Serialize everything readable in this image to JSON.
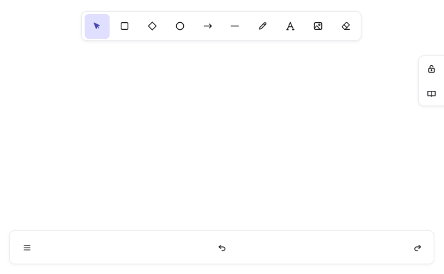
{
  "toolbar": {
    "tools": [
      {
        "id": "selection",
        "icon": "pointer-icon",
        "active": true
      },
      {
        "id": "rectangle",
        "icon": "rectangle-icon",
        "active": false
      },
      {
        "id": "diamond",
        "icon": "diamond-icon",
        "active": false
      },
      {
        "id": "ellipse",
        "icon": "ellipse-icon",
        "active": false
      },
      {
        "id": "arrow",
        "icon": "arrow-icon",
        "active": false
      },
      {
        "id": "line",
        "icon": "line-icon",
        "active": false
      },
      {
        "id": "draw",
        "icon": "pencil-icon",
        "active": false
      },
      {
        "id": "text",
        "icon": "text-icon",
        "active": false
      },
      {
        "id": "image",
        "icon": "image-icon",
        "active": false
      },
      {
        "id": "eraser",
        "icon": "eraser-icon",
        "active": false
      }
    ],
    "text_tool_glyph": "A"
  },
  "side_panel": {
    "items": [
      {
        "id": "lock",
        "icon": "unlock-icon"
      },
      {
        "id": "library",
        "icon": "book-icon"
      }
    ]
  },
  "bottom_bar": {
    "items": [
      {
        "id": "menu",
        "icon": "hamburger-menu-icon"
      },
      {
        "id": "undo",
        "icon": "undo-icon"
      },
      {
        "id": "redo",
        "icon": "redo-icon"
      }
    ]
  },
  "colors": {
    "accent_bg": "#e0dfff",
    "accent_fg": "#4a47b1",
    "border": "#ececf1",
    "icon": "#1b1b1f"
  }
}
